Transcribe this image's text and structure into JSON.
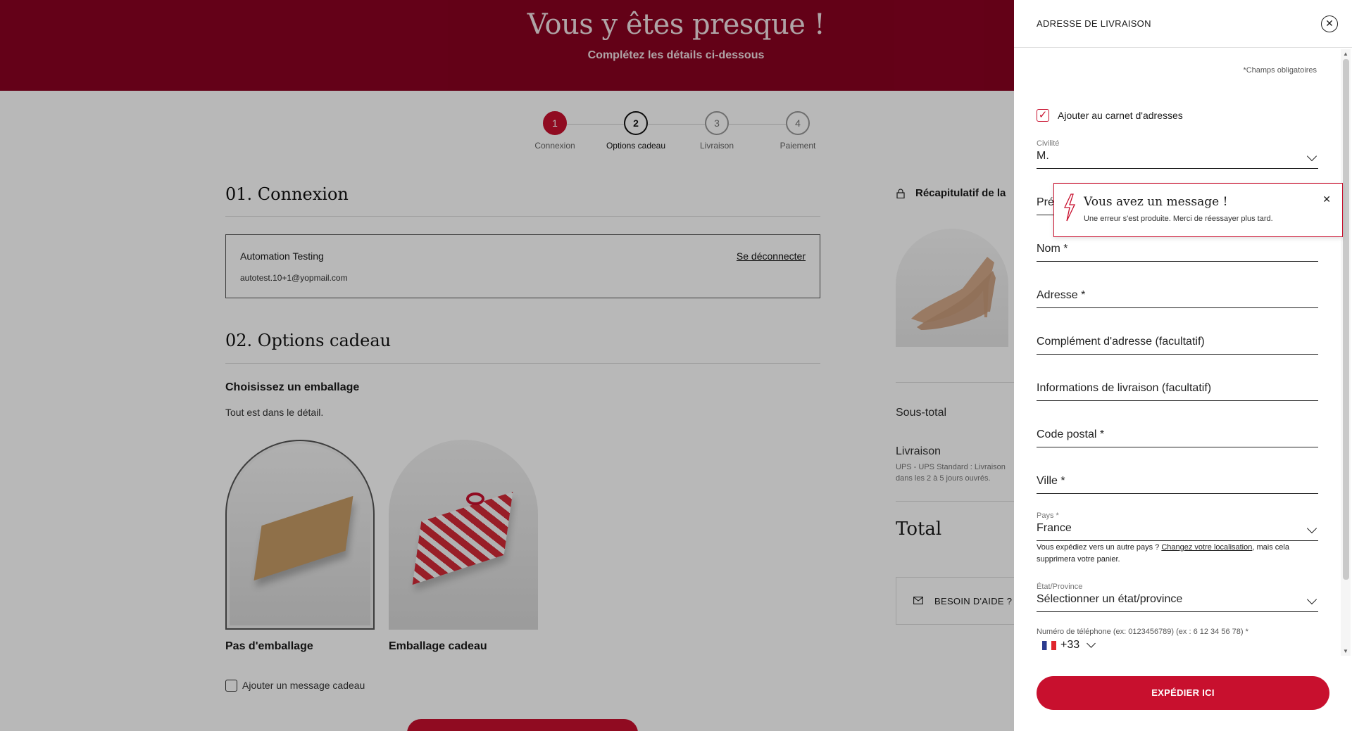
{
  "banner": {
    "title": "Vous y êtes presque !",
    "subtitle": "Complétez les détails ci-dessous"
  },
  "stepper": {
    "steps": [
      {
        "num": "1",
        "label": "Connexion"
      },
      {
        "num": "2",
        "label": "Options cadeau"
      },
      {
        "num": "3",
        "label": "Livraison"
      },
      {
        "num": "4",
        "label": "Paiement"
      }
    ]
  },
  "login": {
    "heading": "01. Connexion",
    "name": "Automation Testing",
    "email": "autotest.10+1@yopmail.com",
    "logout": "Se déconnecter"
  },
  "gift": {
    "heading": "02. Options cadeau",
    "wrap_title": "Choisissez un emballage",
    "wrap_sub": "Tout est dans le détail.",
    "option1": "Pas d'emballage",
    "option2": "Emballage cadeau",
    "message_label": "Ajouter un message cadeau"
  },
  "summary": {
    "title": "Récapitulatif de la",
    "subtotal": "Sous-total",
    "shipping": "Livraison",
    "shipping_detail": "UPS - UPS Standard : Livraison dans les 2 à 5 jours ouvrés.",
    "total": "Total",
    "help": "BESOIN D'AIDE ?"
  },
  "drawer": {
    "title": "ADRESSE DE LIVRAISON",
    "required_note": "*Champs obligatoires",
    "address_book": "Ajouter au carnet d'adresses",
    "civility_label": "Civilité",
    "civility_value": "M.",
    "firstname_partial": "Prén",
    "lastname": "Nom *",
    "address": "Adresse *",
    "address2": "Complément d'adresse (facultatif)",
    "delivery_info": "Informations de livraison (facultatif)",
    "postal": "Code postal *",
    "city": "Ville *",
    "country_label": "Pays *",
    "country_value": "France",
    "country_note_pre": "Vous expédiez vers un autre pays ? ",
    "country_note_link": "Changez votre localisation",
    "country_note_post": ", mais cela supprimera votre panier.",
    "state_label": "État/Province",
    "state_value": "Sélectionner un état/province",
    "phone_label": "Numéro de téléphone (ex: 0123456789) (ex : 6 12 34 56 78) *",
    "phone_code": "+33",
    "submit": "EXPÉDIER ICI"
  },
  "toast": {
    "title": "Vous avez un message !",
    "message": "Une erreur s'est produite. Merci de réessayer plus tard."
  },
  "colors": {
    "brand": "#8a0221",
    "accent": "#c8102e"
  }
}
